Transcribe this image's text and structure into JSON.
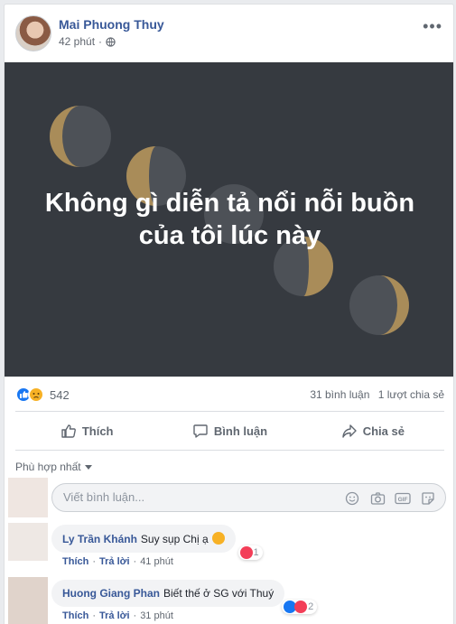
{
  "post": {
    "author": "Mai Phuong Thuy",
    "time": "42 phút",
    "privacy_icon": "globe-icon",
    "more_icon": "more-options-icon"
  },
  "cover": {
    "text_line1": "Không gì diễn tả nổi nỗi buồn",
    "text_line2": "của tôi lúc này",
    "background": "#363a40",
    "moon_gold": "#a98c59",
    "moon_dark": "#4d5157"
  },
  "stats": {
    "reaction_count": "542",
    "comments": "31 bình luận",
    "shares": "1 lượt chia sẻ",
    "reaction_icons": [
      "like-reaction-icon",
      "sad-reaction-icon"
    ]
  },
  "actions": {
    "like": "Thích",
    "comment": "Bình luận",
    "share": "Chia sẻ"
  },
  "comments_section": {
    "sort_label": "Phù hợp nhất",
    "composer_placeholder": "Viết bình luận...",
    "composer_icons": [
      "emoji-icon",
      "camera-icon",
      "gif-icon",
      "sticker-icon"
    ]
  },
  "comments": [
    {
      "name": "Ly Trần Khánh",
      "text": "Suy sụp Chị ạ",
      "like_label": "Thích",
      "reply_label": "Trả lời",
      "time": "41 phút",
      "reaction_count": "1",
      "reactions": [
        "love-reaction-icon"
      ]
    },
    {
      "name": "Huong Giang Phan",
      "text": "Biết thế ở SG với Thuý",
      "like_label": "Thích",
      "reply_label": "Trả lời",
      "time": "31 phút",
      "reaction_count": "2",
      "reactions": [
        "like-reaction-icon",
        "love-reaction-icon"
      ]
    }
  ],
  "colors": {
    "link_blue": "#385898",
    "like_blue": "#1877f2",
    "love_red": "#f33e58",
    "sad_yellow": "#f7b125"
  }
}
